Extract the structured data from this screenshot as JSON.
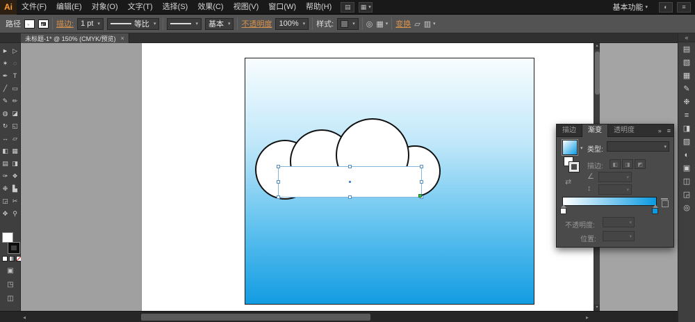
{
  "menu_bar": {
    "logo": "Ai",
    "items": [
      "文件(F)",
      "编辑(E)",
      "对象(O)",
      "文字(T)",
      "选择(S)",
      "效果(C)",
      "视图(V)",
      "窗口(W)",
      "帮助(H)"
    ],
    "workspace": "基本功能"
  },
  "control_bar": {
    "context_label": "路径",
    "stroke_label": "描边:",
    "stroke_value": "1 pt",
    "width_profile_label": "等比",
    "brush_name": "基本",
    "opacity_label": "不透明度",
    "opacity_value": "100%",
    "style_label": "样式:",
    "transform_label": "变换"
  },
  "document_tab": {
    "title": "未标题-1* @ 150% (CMYK/预览)",
    "close_glyph": "×"
  },
  "toolbar": {
    "tools": [
      {
        "name": "selection",
        "glyph": "►"
      },
      {
        "name": "direct-selection",
        "glyph": "▷"
      },
      {
        "name": "magic-wand",
        "glyph": "✶"
      },
      {
        "name": "lasso",
        "glyph": "◌"
      },
      {
        "name": "pen",
        "glyph": "✒"
      },
      {
        "name": "type",
        "glyph": "T"
      },
      {
        "name": "line-segment",
        "glyph": "╱"
      },
      {
        "name": "rectangle",
        "glyph": "▭"
      },
      {
        "name": "paintbrush",
        "glyph": "✎"
      },
      {
        "name": "pencil",
        "glyph": "✏"
      },
      {
        "name": "blob-brush",
        "glyph": "◍"
      },
      {
        "name": "eraser",
        "glyph": "◪"
      },
      {
        "name": "rotate",
        "glyph": "↻"
      },
      {
        "name": "scale",
        "glyph": "◱"
      },
      {
        "name": "width",
        "glyph": "↔"
      },
      {
        "name": "free-transform",
        "glyph": "▱"
      },
      {
        "name": "shape-builder",
        "glyph": "◧"
      },
      {
        "name": "perspective-grid",
        "glyph": "▦"
      },
      {
        "name": "mesh",
        "glyph": "▤"
      },
      {
        "name": "gradient",
        "glyph": "◨"
      },
      {
        "name": "eyedropper",
        "glyph": "✑"
      },
      {
        "name": "blend",
        "glyph": "❖"
      },
      {
        "name": "symbol-sprayer",
        "glyph": "❉"
      },
      {
        "name": "column-graph",
        "glyph": "▙"
      },
      {
        "name": "artboard",
        "glyph": "◲"
      },
      {
        "name": "slice",
        "glyph": "✂"
      },
      {
        "name": "hand",
        "glyph": "✥"
      },
      {
        "name": "zoom",
        "glyph": "⚲"
      }
    ]
  },
  "right_dock": {
    "collapse_glyph": "«",
    "icons": [
      {
        "name": "color",
        "glyph": "▤"
      },
      {
        "name": "color-guide",
        "glyph": "▧"
      },
      {
        "name": "swatches",
        "glyph": "▦"
      },
      {
        "name": "brushes",
        "glyph": "✎"
      },
      {
        "name": "symbols",
        "glyph": "❉"
      },
      {
        "name": "stroke",
        "glyph": "≡"
      },
      {
        "name": "gradient",
        "glyph": "◨"
      },
      {
        "name": "transparency",
        "glyph": "▨"
      },
      {
        "name": "appearance",
        "glyph": "◐"
      },
      {
        "name": "graphic-styles",
        "glyph": "▣"
      },
      {
        "name": "layers",
        "glyph": "◫"
      },
      {
        "name": "artboards",
        "glyph": "◲"
      },
      {
        "name": "navigator",
        "glyph": "◎"
      }
    ]
  },
  "gradient_panel": {
    "tabs": [
      "描边",
      "渐变",
      "透明度"
    ],
    "active_tab": "渐变",
    "expand_glyph": "»",
    "menu_glyph": "≡",
    "type_label": "类型:",
    "stroke_label": "描边:",
    "opacity_label": "不透明度:",
    "position_label": "位置:",
    "gradient_start_color": "#ffffff",
    "gradient_end_color": "#0a9ae2"
  },
  "canvas": {
    "sky_top_color": "#f8fdff",
    "sky_bottom_color": "#129ce2",
    "cloud_fill": "#ffffff",
    "cloud_stroke": "#111111",
    "selection_color": "#84b6dc",
    "anchor_color": "#3cb54a"
  },
  "icons": {
    "arrange_documents": "▤",
    "document_layout": "▦",
    "cs_live": "◐",
    "document_setup": "◎",
    "align_grid": "▦",
    "transform_extra": "▱",
    "options_extra": "▥",
    "panel_menu": "≡",
    "angle": "∠",
    "aspect_ratio": "↕",
    "reverse_gradient": "⇄",
    "stroke_btn_1": "◧",
    "stroke_btn_2": "◨",
    "stroke_btn_3": "◩",
    "scroll_up": "▴",
    "scroll_down": "▾",
    "scroll_left": "◂",
    "scroll_right": "▸"
  }
}
